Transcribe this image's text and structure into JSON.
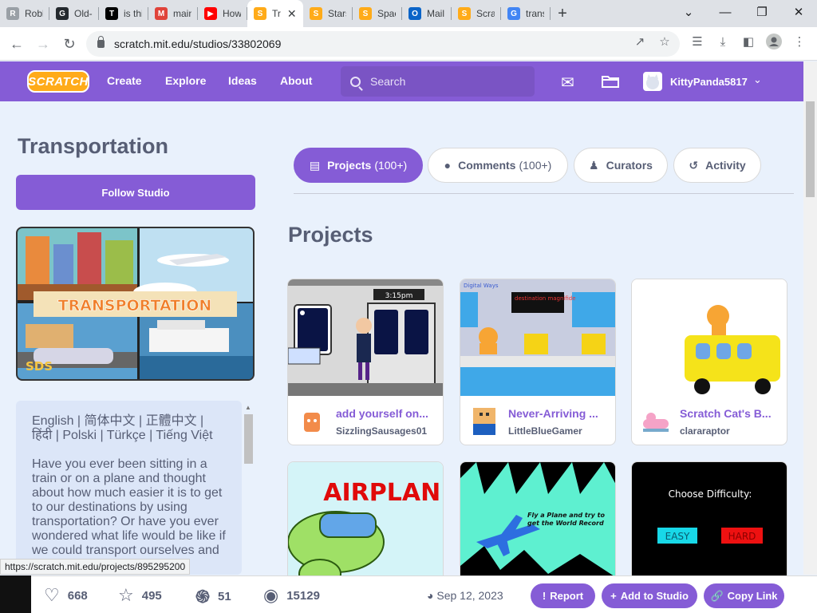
{
  "browser": {
    "tabs": [
      {
        "label": "Roblo",
        "color": "#9aa0a6",
        "glyph": "R"
      },
      {
        "label": "Old-F",
        "color": "#24292e",
        "glyph": "G"
      },
      {
        "label": "is thi",
        "color": "#010101",
        "glyph": "T"
      },
      {
        "label": "main",
        "color": "#e0433a",
        "glyph": "M"
      },
      {
        "label": "How",
        "color": "#ff0000",
        "glyph": "▶"
      },
      {
        "label": "Tr",
        "color": "#ffab19",
        "glyph": "S",
        "active": true
      },
      {
        "label": "Stars",
        "color": "#ffab19",
        "glyph": "S"
      },
      {
        "label": "Spac",
        "color": "#ffab19",
        "glyph": "S"
      },
      {
        "label": "Mail",
        "color": "#0a64c8",
        "glyph": "O"
      },
      {
        "label": "Scrat",
        "color": "#ffab19",
        "glyph": "S"
      },
      {
        "label": "trans",
        "color": "#4285f4",
        "glyph": "G"
      }
    ],
    "url": "scratch.mit.edu/studios/33802069",
    "status_url": "https://scratch.mit.edu/projects/895295200"
  },
  "nav": {
    "logo": "SCRATCH",
    "links": [
      "Create",
      "Explore",
      "Ideas",
      "About"
    ],
    "search_placeholder": "Search",
    "username": "KittyPanda5817"
  },
  "studio": {
    "title": "Transportation",
    "follow_label": "Follow Studio",
    "thumbnail_text": "TRANSPORTATION",
    "thumbnail_badge": "SDS",
    "description": [
      "English | 简体中文 | 正體中文 | हिंदी | Polski | Türkçe | Tiếng Việt",
      "Have you ever been sitting in a train or on a plane and thought about how much easier it is to get to our destinations by using transportation? Or have you ever wondered what life would be like if we could transport ourselves and"
    ]
  },
  "tabs": [
    {
      "label": "Projects",
      "count": "(100+)",
      "icon": "projects-icon",
      "active": true
    },
    {
      "label": "Comments",
      "count": "(100+)",
      "icon": "comment-icon"
    },
    {
      "label": "Curators",
      "count": "",
      "icon": "curators-icon"
    },
    {
      "label": "Activity",
      "count": "",
      "icon": "history-icon"
    }
  ],
  "projects_heading": "Projects",
  "projects": [
    {
      "title": "add yourself on...",
      "author": "SizzlingSausages01",
      "clock": "3:15pm"
    },
    {
      "title": "Never-Arriving ...",
      "author": "LittleBlueGamer",
      "tag": "Digital Ways",
      "sign": "destination magnifide"
    },
    {
      "title": "Scratch Cat's B...",
      "author": "clararaptor"
    }
  ],
  "projects_row2": [
    {
      "text": "AIRPLANE"
    },
    {
      "text": "Fly a Plane and try to get the World Record"
    },
    {
      "text": "Choose Difficulty:",
      "easy": "EASY",
      "hard": "HARD"
    }
  ],
  "footer": {
    "loves": "668",
    "favorites": "495",
    "remixes": "51",
    "views": "15129",
    "date": "Sep 12, 2023",
    "report": "Report",
    "add_to_studio": "Add to Studio",
    "copy_link": "Copy Link"
  }
}
